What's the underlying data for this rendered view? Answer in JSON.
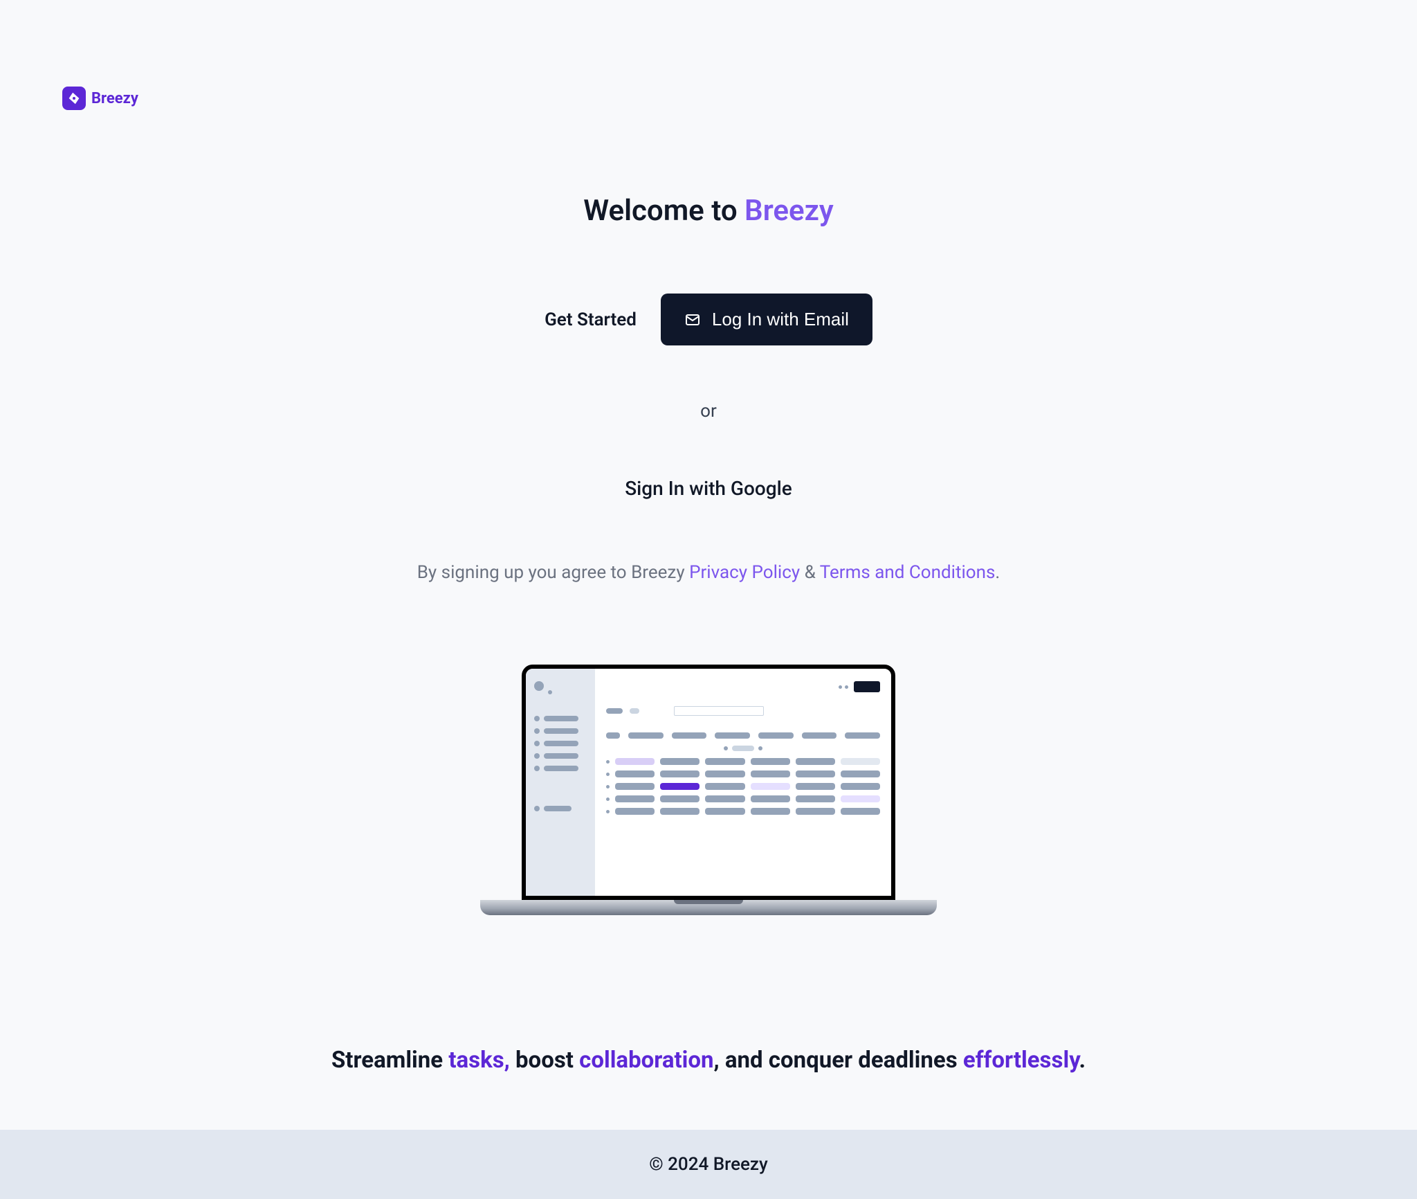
{
  "brand": {
    "name": "Breezy"
  },
  "title": {
    "prefix": "Welcome to ",
    "brand": "Breezy"
  },
  "actions": {
    "get_started": "Get Started",
    "login_email": "Log In with Email",
    "or": "or",
    "google_signin": "Sign In with Google"
  },
  "legal": {
    "prefix": "By signing up you agree to Breezy ",
    "privacy": "Privacy Policy",
    "amp": " & ",
    "terms": "Terms and Conditions",
    "suffix": "."
  },
  "tagline": {
    "t1": "Streamline ",
    "h1": "tasks,",
    "t2": " boost ",
    "h2": "collaboration",
    "t3": ", and conquer deadlines ",
    "h3": "effortlessly",
    "t4": "."
  },
  "footer": {
    "copyright": "© 2024 Breezy"
  }
}
